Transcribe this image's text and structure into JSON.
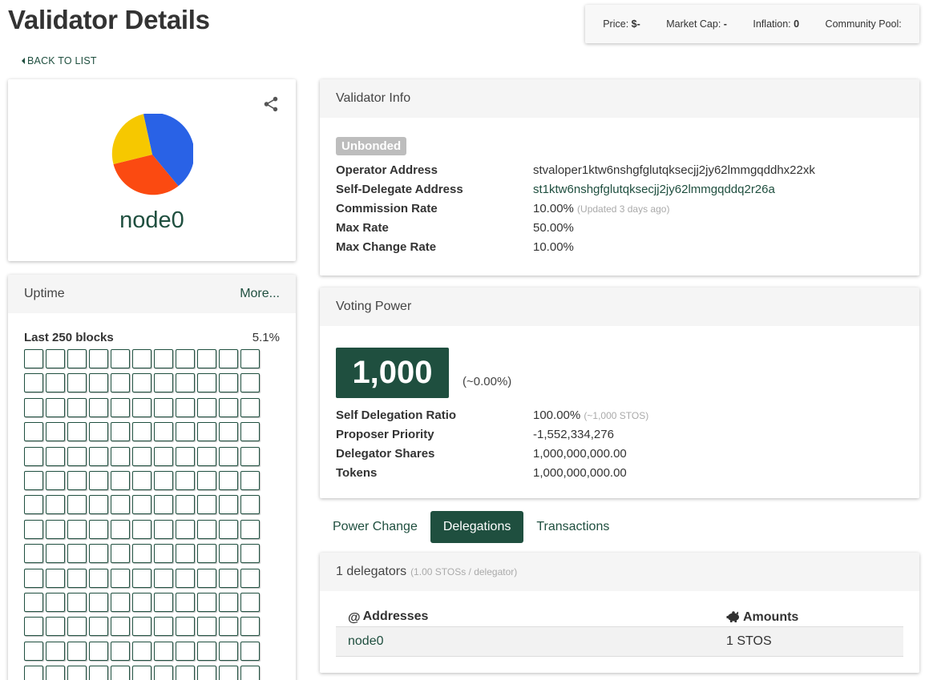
{
  "page": {
    "title": "Validator Details",
    "back_label": "BACK TO LIST"
  },
  "market": {
    "price_label": "Price:",
    "price_value": "$-",
    "market_cap_label": "Market Cap:",
    "market_cap_value": "-",
    "inflation_label": "Inflation:",
    "inflation_value": "0",
    "community_pool_label": "Community Pool:",
    "community_pool_value": ""
  },
  "profile": {
    "moniker": "node0",
    "avatar_colors": {
      "blue": "#2962e6",
      "orange": "#fb4a11",
      "yellow": "#f6c800"
    },
    "share_icon": "share-icon"
  },
  "uptime": {
    "title": "Uptime",
    "more_label": "More...",
    "blocks_label": "Last 250 blocks",
    "blocks_pct": "5.1%"
  },
  "validator_info": {
    "title": "Validator Info",
    "status": "Unbonded",
    "rows": [
      {
        "key": "Operator Address",
        "value": "stvaloper1ktw6nshgfglutqksecjj2jy62lmmgqddhx22xk",
        "note": ""
      },
      {
        "key": "Self-Delegate Address",
        "value": "st1ktw6nshgfglutqksecjj2jy62lmmgqddq2r26a",
        "note": ""
      },
      {
        "key": "Commission Rate",
        "value": "10.00%",
        "note": "(Updated 3 days ago)"
      },
      {
        "key": "Max Rate",
        "value": "50.00%",
        "note": ""
      },
      {
        "key": "Max Change Rate",
        "value": "10.00%",
        "note": ""
      }
    ]
  },
  "voting_power": {
    "title": "Voting Power",
    "power": "1,000",
    "percent": "(~0.00%)",
    "rows": [
      {
        "key": "Self Delegation Ratio",
        "value": "100.00%",
        "note": "(~1,000 STOS)"
      },
      {
        "key": "Proposer Priority",
        "value": "-1,552,334,276",
        "note": ""
      },
      {
        "key": "Delegator Shares",
        "value": "1,000,000,000.00",
        "note": ""
      },
      {
        "key": "Tokens",
        "value": "1,000,000,000.00",
        "note": ""
      }
    ]
  },
  "tabs": [
    {
      "label": "Power Change",
      "active": false
    },
    {
      "label": "Delegations",
      "active": true
    },
    {
      "label": "Transactions",
      "active": false
    }
  ],
  "delegations": {
    "count_label": "1 delegators",
    "count_note": "(1.00 STOSs / delegator)",
    "col_addresses": "Addresses",
    "col_amounts": "Amounts",
    "rows": [
      {
        "address": "node0",
        "amount": "1 STOS"
      }
    ]
  },
  "colors": {
    "brand": "#1f4f3f",
    "badge_unbonded": "#bdbdbd"
  }
}
